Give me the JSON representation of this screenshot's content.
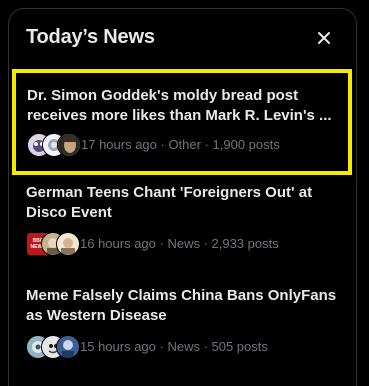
{
  "widget": {
    "title": "Today’s News",
    "close_icon": "close-icon"
  },
  "news_items": [
    {
      "headline_line1": "Dr. Simon Goddek's moldy bread post",
      "headline_line2": "receives more likes than Mark R. Levin's ...",
      "meta": "17 hours ago · Other · 1,900 posts",
      "highlighted": true,
      "highlight_color": "#f5e900"
    },
    {
      "headline_line1": "German Teens Chant 'Foreigners Out' at",
      "headline_line2": "Disco Event",
      "meta": "16 hours ago · News · 2,933 posts",
      "avatar_badge": "BBC NEWS"
    },
    {
      "headline_line1": "Meme Falsely Claims China Bans OnlyFans",
      "headline_line2": "as Western Disease",
      "meta": "15 hours ago · News · 505 posts"
    }
  ],
  "colors": {
    "background": "#000000",
    "headline": "#e7e9ea",
    "meta": "#71767b",
    "border": "#2f3336"
  }
}
